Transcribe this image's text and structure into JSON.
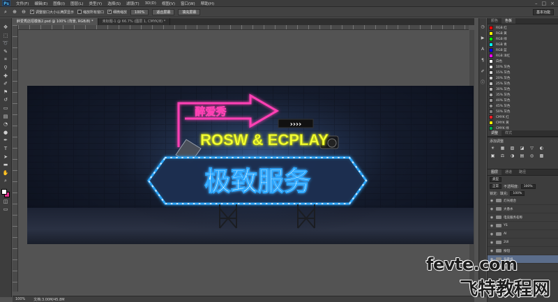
{
  "app": {
    "logo_text": "Ps",
    "menus": [
      "文件(F)",
      "编辑(E)",
      "图像(I)",
      "图层(L)",
      "类型(Y)",
      "选择(S)",
      "滤镜(T)",
      "3D(D)",
      "视图(V)",
      "窗口(W)",
      "帮助(H)"
    ],
    "window_controls": [
      "–",
      "□",
      "×"
    ]
  },
  "options_bar": {
    "checks": [
      {
        "label": "调整窗口大小以满屏显示",
        "checked": true
      },
      {
        "label": "缩放所有窗口",
        "checked": false
      },
      {
        "label": "细微缩放",
        "checked": true
      }
    ],
    "buttons": [
      "100%",
      "适合屏幕",
      "填充屏幕"
    ],
    "workspace": "基本功能"
  },
  "document": {
    "tab_active": "醉爱秀店招模板2.psd @ 100% (背景, RGB/8) *",
    "tab_other": "未标题-1 @ 66.7% (图层 1, CMYK/8) *",
    "canvas": {
      "top_sign_text": "醉爱秀",
      "arrows": "››››",
      "brand_text": "ROSW & ECPLAY",
      "main_text": "极致服务"
    }
  },
  "status": {
    "zoom": "100%",
    "doc_info": "文档:3.00M/45.8M"
  },
  "swatches": {
    "tabs": [
      "颜色",
      "色板"
    ],
    "items": [
      {
        "label": "RGB 红",
        "color": "#ff0000"
      },
      {
        "label": "RGB 黄",
        "color": "#ffff00"
      },
      {
        "label": "RGB 绿",
        "color": "#00ff00"
      },
      {
        "label": "RGB 青",
        "color": "#00ffff"
      },
      {
        "label": "RGB 蓝",
        "color": "#0000ff"
      },
      {
        "label": "RGB 洋红",
        "color": "#ff00ff"
      },
      {
        "label": "白色",
        "color": "#ffffff"
      },
      {
        "label": "10% 灰色",
        "color": "#e6e6e6"
      },
      {
        "label": "15% 灰色",
        "color": "#d9d9d9"
      },
      {
        "label": "20% 灰色",
        "color": "#cccccc"
      },
      {
        "label": "25% 灰色",
        "color": "#bfbfbf"
      },
      {
        "label": "30% 灰色",
        "color": "#b3b3b3"
      },
      {
        "label": "35% 灰色",
        "color": "#a6a6a6"
      },
      {
        "label": "40% 灰色",
        "color": "#999999"
      },
      {
        "label": "45% 灰色",
        "color": "#8c8c8c"
      },
      {
        "label": "50% 灰色",
        "color": "#808080"
      },
      {
        "label": "CMYK 红",
        "color": "#ed1c24"
      },
      {
        "label": "CMYK 黄",
        "color": "#fff200"
      },
      {
        "label": "CMYK 绿",
        "color": "#00a651"
      }
    ]
  },
  "adjustments": {
    "tabs": [
      "调整",
      "样式"
    ],
    "title": "添加调整",
    "icons": [
      "☀",
      "▦",
      "▨",
      "◪",
      "▽",
      "◐",
      "▣",
      "⚖",
      "◑",
      "▤",
      "◎",
      "▩"
    ]
  },
  "layers": {
    "tabs": [
      "图层",
      "通道",
      "路径"
    ],
    "kind": "类型",
    "mode": "正常",
    "opacity_label": "不透明度:",
    "opacity": "100%",
    "fill_label": "填充:",
    "fill": "100%",
    "lock_label": "锁定:",
    "items": [
      {
        "name": "灯光组合",
        "selected": false
      },
      {
        "name": "大香水",
        "selected": false
      },
      {
        "name": "电竞服务名称",
        "selected": false
      },
      {
        "name": "YS",
        "selected": false
      },
      {
        "name": "AI",
        "selected": false
      },
      {
        "name": "2UI",
        "selected": false
      },
      {
        "name": "按钮",
        "selected": false
      },
      {
        "name": "背景组",
        "selected": true
      },
      {
        "name": "背景图",
        "selected": false
      }
    ]
  },
  "watermark": {
    "line1": "fevte.com",
    "line2": "飞特教程网"
  },
  "colors": {
    "neon_pink": "#ff3fb4",
    "neon_yellow": "#f4ff3a",
    "neon_blue": "#2fa8ff",
    "foreground": "#ffffff",
    "background": "#e4328f"
  }
}
